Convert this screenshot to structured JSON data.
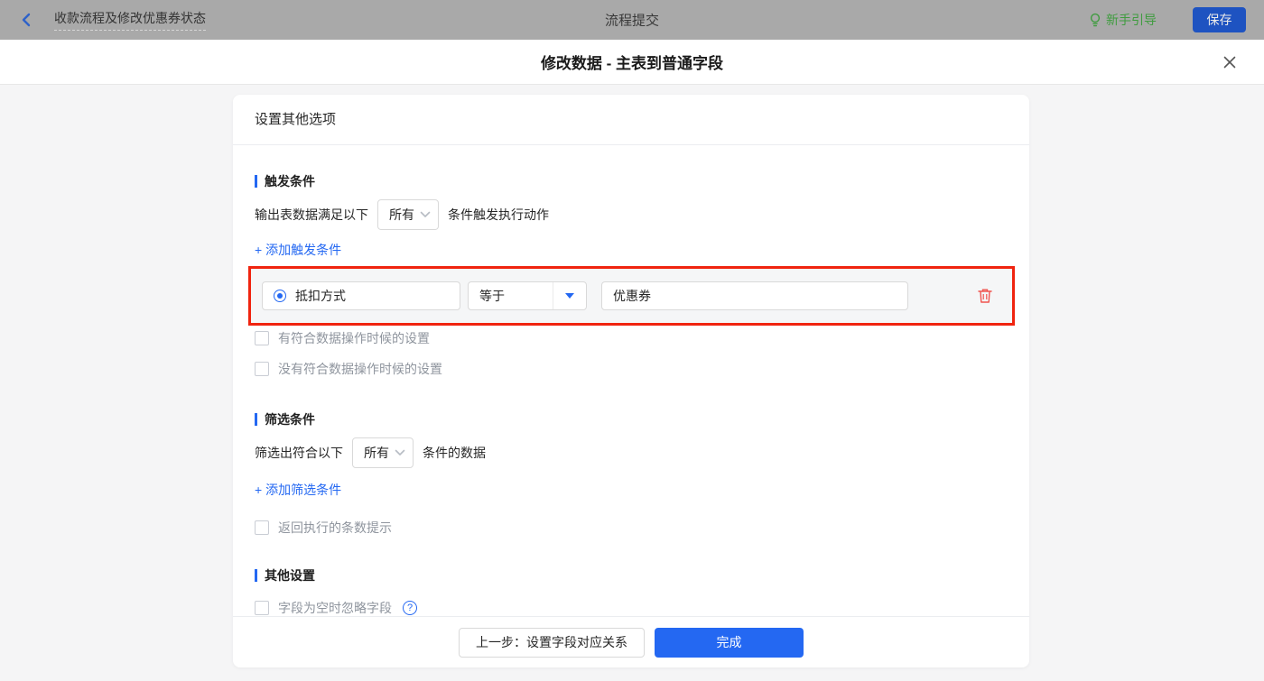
{
  "topbar": {
    "back_title": "收款流程及修改优惠券状态",
    "center_title": "流程提交",
    "guide_label": "新手引导",
    "save_label": "保存"
  },
  "modal": {
    "title": "修改数据 - 主表到普通字段",
    "card": {
      "header": "设置其他选项",
      "trigger_section": {
        "title": "触发条件",
        "prefix": "输出表数据满足以下",
        "select_value": "所有",
        "suffix": "条件触发执行动作",
        "add_link": "+ 添加触发条件",
        "condition_row": {
          "field": "抵扣方式",
          "operator": "等于",
          "value": "优惠券"
        },
        "checkbox_has_match": "有符合数据操作时候的设置",
        "checkbox_no_match": "没有符合数据操作时候的设置"
      },
      "filter_section": {
        "title": "筛选条件",
        "prefix": "筛选出符合以下",
        "select_value": "所有",
        "suffix": "条件的数据",
        "add_link": "+ 添加筛选条件",
        "checkbox_count_tip": "返回执行的条数提示"
      },
      "other_section": {
        "title": "其他设置",
        "checkbox_ignore_empty": "字段为空时忽略字段"
      },
      "footer": {
        "prev_label": "上一步：设置字段对应关系",
        "done_label": "完成"
      }
    }
  },
  "icons": {
    "help_glyph": "?"
  },
  "colors": {
    "accent_blue": "#2468f2",
    "annotation_red": "#f0240f",
    "trash_red": "#f0544f",
    "guide_green": "#3f9c3f",
    "dimmed_topbar_gray": "#a9a9a9",
    "page_background": "#f5f5f6"
  }
}
